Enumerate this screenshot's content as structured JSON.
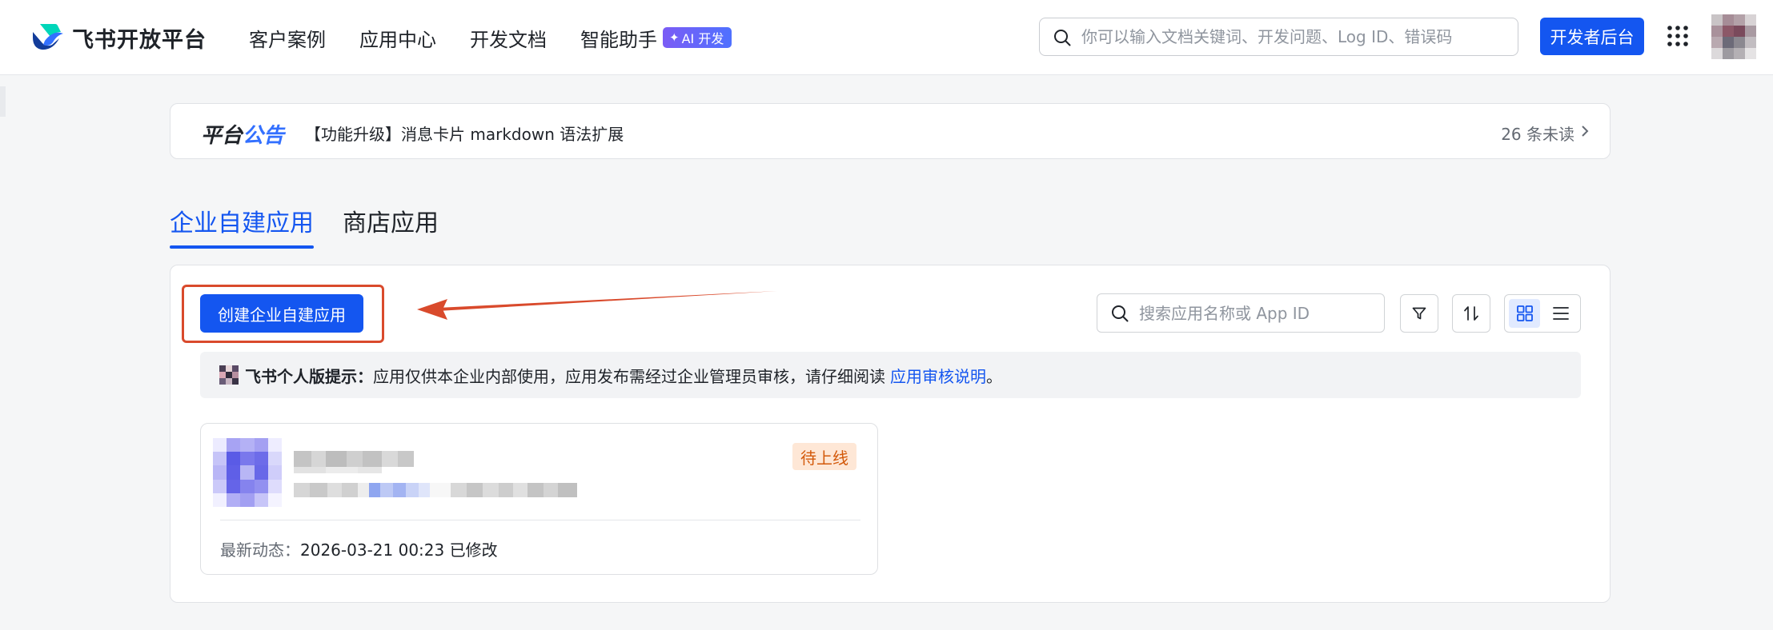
{
  "header": {
    "logo_text": "飞书开放平台",
    "nav": [
      {
        "label": "客户案例"
      },
      {
        "label": "应用中心"
      },
      {
        "label": "开发文档"
      },
      {
        "label": "智能助手"
      }
    ],
    "ai_badge": "AI 开发",
    "search_placeholder": "你可以输入文档关键词、开发问题、Log ID、错误码",
    "search_value": "",
    "dev_button": "开发者后台",
    "icons": {
      "logo": "feishu-logo-icon",
      "search": "search-icon",
      "apps": "grid-dots-icon",
      "avatar": "user-avatar"
    }
  },
  "announcement": {
    "title_a": "平台",
    "title_b": "公告",
    "text": "【功能升级】消息卡片 markdown 语法扩展",
    "unread": "26 条未读"
  },
  "tabs": [
    {
      "label": "企业自建应用",
      "active": true
    },
    {
      "label": "商店应用",
      "active": false
    }
  ],
  "toolbar": {
    "create_button": "创建企业自建应用",
    "search_placeholder": "搜索应用名称或 App ID",
    "search_value": "",
    "icons": [
      "filter-icon",
      "sort-icon",
      "grid-view-icon",
      "list-view-icon"
    ],
    "active_view": "grid"
  },
  "tip": {
    "label": "飞书个人版提示：",
    "text": "应用仅供本企业内部使用，应用发布需经过企业管理员审核，请仔细阅读",
    "link": "应用审核说明",
    "end": "。"
  },
  "app_card": {
    "status": "待上线",
    "meta_label": "最新动态：",
    "meta_value": "2026-03-21 00:23 已修改"
  },
  "colors": {
    "brand_blue": "#1456f0",
    "accent_blue": "#3370ff",
    "annotation_red": "#d94a2c",
    "status_orange": "#d3590a",
    "status_bg": "#fee7d6",
    "tip_bg": "#f2f3f5"
  }
}
